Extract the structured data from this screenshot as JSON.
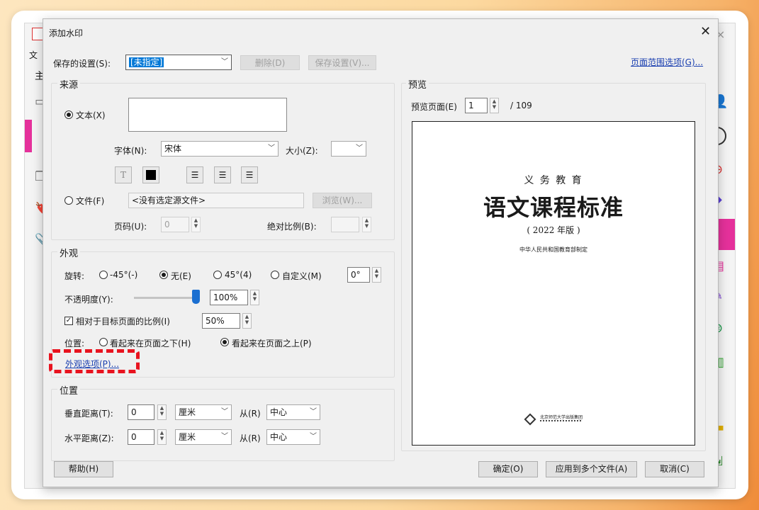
{
  "dialog": {
    "title": "添加水印",
    "saved_settings_label": "保存的设置(S):",
    "saved_settings_value": "[未指定]",
    "delete_btn": "删除(D)",
    "save_settings_btn": "保存设置(V)...",
    "page_range_link": "页面范围选项(G)..."
  },
  "source": {
    "legend": "来源",
    "text_radio": "文本(X)",
    "font_label": "字体(N):",
    "font_value": "宋体",
    "size_label": "大小(Z):",
    "size_value": "",
    "color_value": "#000000",
    "file_radio": "文件(F)",
    "file_path": "<没有选定源文件>",
    "browse_btn": "浏览(W)...",
    "page_label": "页码(U):",
    "page_value": "0",
    "abs_scale_label": "绝对比例(B):",
    "abs_scale_value": ""
  },
  "appearance": {
    "legend": "外观",
    "rotation_label": "旋转:",
    "rot_options": [
      "-45°(-)",
      "无(E)",
      "45°(4)",
      "自定义(M)"
    ],
    "rot_selected": "无(E)",
    "custom_angle": "0°",
    "opacity_label": "不透明度(Y):",
    "opacity_value": "100%",
    "opacity_level": 1.0,
    "relative_scale_label": "相对于目标页面的比例(I)",
    "relative_scale_value": "50%",
    "position_label": "位置:",
    "behind_page": "看起来在页面之下(H)",
    "above_page": "看起来在页面之上(P)",
    "options_link": "外观选项(P)..."
  },
  "position": {
    "legend": "位置",
    "vertical_label": "垂直距离(T):",
    "vertical_value": "0",
    "vertical_unit": "厘米",
    "vertical_from_label": "从(R)",
    "vertical_from": "中心",
    "horizontal_label": "水平距离(Z):",
    "horizontal_value": "0",
    "horizontal_unit": "厘米",
    "horizontal_from_label": "从(R)",
    "horizontal_from": "中心"
  },
  "preview": {
    "legend": "预览",
    "page_label": "预览页面(E)",
    "page_value": "1",
    "total": "/ 109",
    "doc_series": "义 务 教 育",
    "doc_title": "语文课程标准",
    "doc_edition": "( 2022 年版 )",
    "doc_issuer": "中华人民共和国教育部制定",
    "doc_publisher": "北京师范大学出版集团"
  },
  "footer": {
    "help_btn": "帮助(H)",
    "ok_btn": "确定(O)",
    "apply_multi_btn": "应用到多个文件(A)",
    "cancel_btn": "取消(C)"
  },
  "background": {
    "menu_file": "文",
    "tab_text": "主"
  },
  "colors": {
    "highlight_dash": "#e8131f",
    "link": "#1a3fb0",
    "selection": "#0078d7",
    "accent_pink": "#e5319b"
  }
}
